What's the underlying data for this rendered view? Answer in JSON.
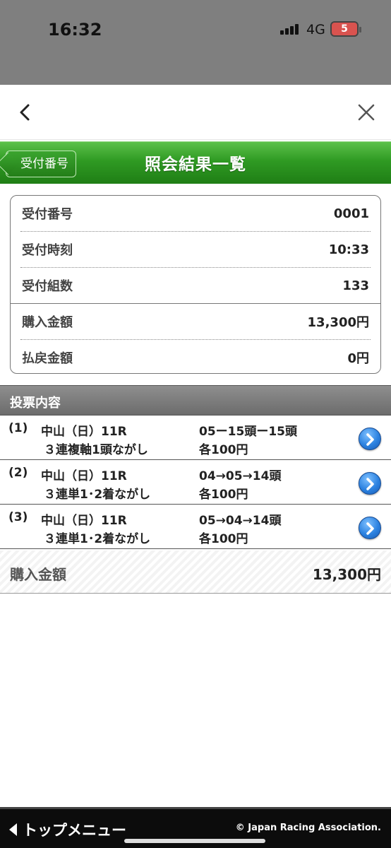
{
  "status": {
    "time": "16:32",
    "network": "4G",
    "battery": "5"
  },
  "header": {
    "back_label": "受付番号",
    "title": "照会結果一覧"
  },
  "receipt": [
    {
      "label": "受付番号",
      "value": "0001"
    },
    {
      "label": "受付時刻",
      "value": "10:33"
    },
    {
      "label": "受付組数",
      "value": "133"
    },
    {
      "label": "購入金額",
      "value": "13,300円"
    },
    {
      "label": "払戻金額",
      "value": "0円"
    }
  ],
  "section": {
    "title": "投票内容"
  },
  "bets": [
    {
      "num": "(1)",
      "race": "中山（日）11R",
      "kind": "３連複軸1頭ながし",
      "combo": "05ー15頭ー15頭",
      "amount": "各100円"
    },
    {
      "num": "(2)",
      "race": "中山（日）11R",
      "kind": "３連単1･2着ながし",
      "combo": "04→05→14頭",
      "amount": "各100円"
    },
    {
      "num": "(3)",
      "race": "中山（日）11R",
      "kind": "３連単1･2着ながし",
      "combo": "05→04→14頭",
      "amount": "各100円"
    }
  ],
  "total": {
    "label": "購入金額",
    "value": "13,300円"
  },
  "footer": {
    "menu_label": "トップメニュー",
    "copyright": "© Japan Racing Association."
  },
  "colors": {
    "header_green": "#2f9a23",
    "section_gray": "#7a7a7a",
    "arrow_blue": "#2c82e0"
  }
}
